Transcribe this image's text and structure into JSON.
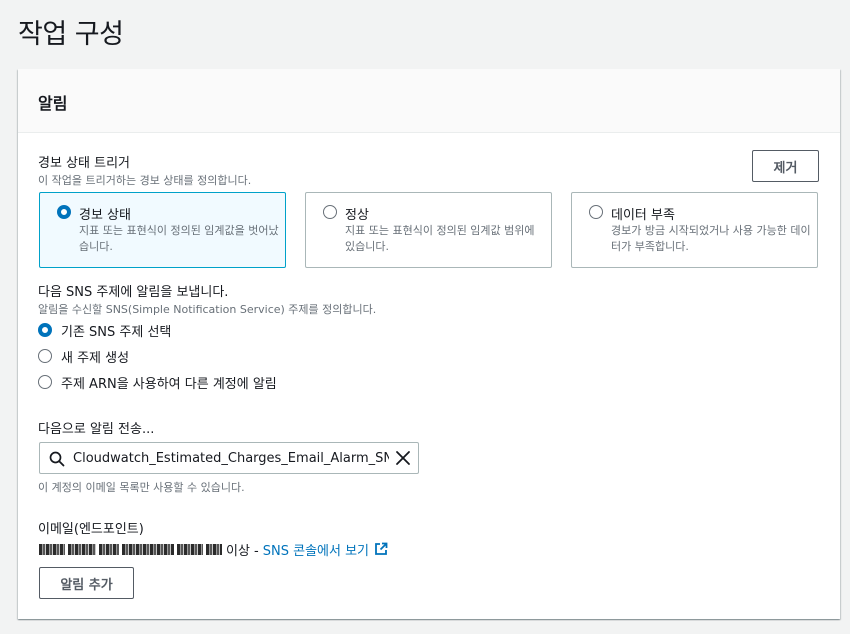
{
  "page": {
    "title": "작업 구성"
  },
  "panel": {
    "title": "알림",
    "remove_label": "제거",
    "add_label": "알림 추가"
  },
  "trigger": {
    "label": "경보 상태 트리거",
    "description": "이 작업을 트리거하는 경보 상태를 정의합니다.",
    "tiles": [
      {
        "label": "경보 상태",
        "desc": "지표 또는 표현식이 정의된 임계값을 벗어났습니다.",
        "selected": true
      },
      {
        "label": "정상",
        "desc": "지표 또는 표현식이 정의된 임계값 범위에 있습니다.",
        "selected": false
      },
      {
        "label": "데이터 부족",
        "desc": "경보가 방금 시작되었거나 사용 가능한 데이터가 부족합니다.",
        "selected": false
      }
    ]
  },
  "sns": {
    "label": "다음 SNS 주제에 알림을 보냅니다.",
    "description": "알림을 수신할 SNS(Simple Notification Service) 주제를 정의합니다.",
    "options": [
      {
        "label": "기존 SNS 주제 선택",
        "selected": true
      },
      {
        "label": "새 주제 생성",
        "selected": false
      },
      {
        "label": "주제 ARN을 사용하여 다른 계정에 알림",
        "selected": false
      }
    ]
  },
  "send_to": {
    "label": "다음으로 알림 전송...",
    "value": "Cloudwatch_Estimated_Charges_Email_Alarm_SNS",
    "hint": "이 계정의 이메일 목록만 사용할 수 있습니다."
  },
  "email": {
    "label": "이메일(엔드포인트)",
    "suffix": "이상 -",
    "link": "SNS 콘솔에서 보기"
  },
  "colors": {
    "accent": "#0073bb",
    "selected_border": "#00a1c9",
    "selected_bg": "#f1faff"
  }
}
